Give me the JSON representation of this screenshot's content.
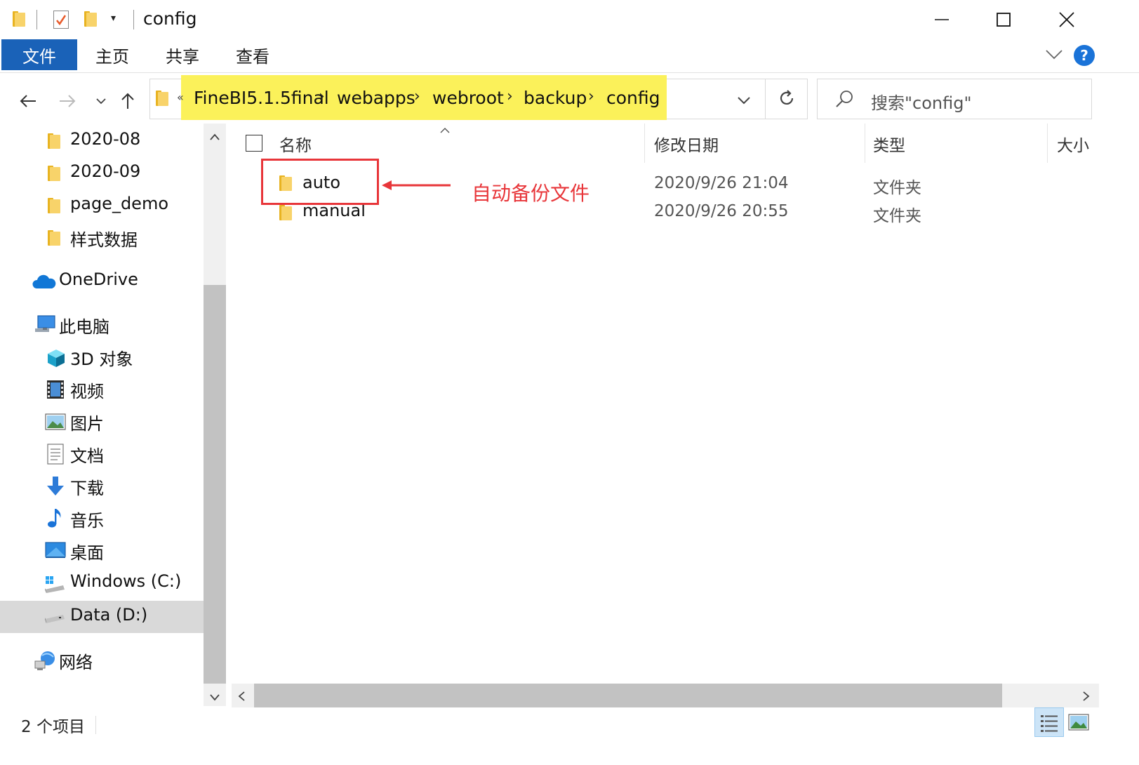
{
  "window": {
    "title": "config",
    "minimize_icon": "minimize-icon",
    "maximize_icon": "maximize-icon",
    "close_icon": "close-icon"
  },
  "ribbon": {
    "tabs": [
      {
        "label": "文件",
        "active": true
      },
      {
        "label": "主页"
      },
      {
        "label": "共享"
      },
      {
        "label": "查看"
      }
    ],
    "help_label": "?"
  },
  "address": {
    "overflow": "«",
    "crumbs": [
      "FineBI5.1.5final",
      "webapps",
      "webroot",
      "backup",
      "config"
    ],
    "highlight_color": "#fbf15a"
  },
  "search": {
    "placeholder": "搜索\"config\""
  },
  "nav": {
    "items": [
      {
        "label": "2020-08",
        "icon": "folder-icon"
      },
      {
        "label": "2020-09",
        "icon": "folder-icon"
      },
      {
        "label": "page_demo",
        "icon": "folder-icon"
      },
      {
        "label": "样式数据",
        "icon": "folder-icon"
      },
      {
        "label": "OneDrive",
        "icon": "onedrive-icon"
      },
      {
        "label": "此电脑",
        "icon": "pc-icon"
      },
      {
        "label": "3D 对象",
        "icon": "3d-objects-icon"
      },
      {
        "label": "视频",
        "icon": "video-icon"
      },
      {
        "label": "图片",
        "icon": "pictures-icon"
      },
      {
        "label": "文档",
        "icon": "documents-icon"
      },
      {
        "label": "下载",
        "icon": "download-icon"
      },
      {
        "label": "音乐",
        "icon": "music-icon"
      },
      {
        "label": "桌面",
        "icon": "desktop-icon"
      },
      {
        "label": "Windows (C:)",
        "icon": "windows-drive-icon"
      },
      {
        "label": "Data (D:)",
        "icon": "drive-icon",
        "selected": true
      },
      {
        "label": "网络",
        "icon": "network-icon"
      }
    ]
  },
  "columns": {
    "name": "名称",
    "date": "修改日期",
    "type": "类型",
    "size": "大小"
  },
  "files": [
    {
      "name": "auto",
      "date": "2020/9/26 21:04",
      "type": "文件夹"
    },
    {
      "name": "manual",
      "date": "2020/9/26 20:55",
      "type": "文件夹"
    }
  ],
  "annotation": {
    "text": "自动备份文件",
    "color": "#e8363a"
  },
  "status": {
    "count": "2 个项目"
  }
}
